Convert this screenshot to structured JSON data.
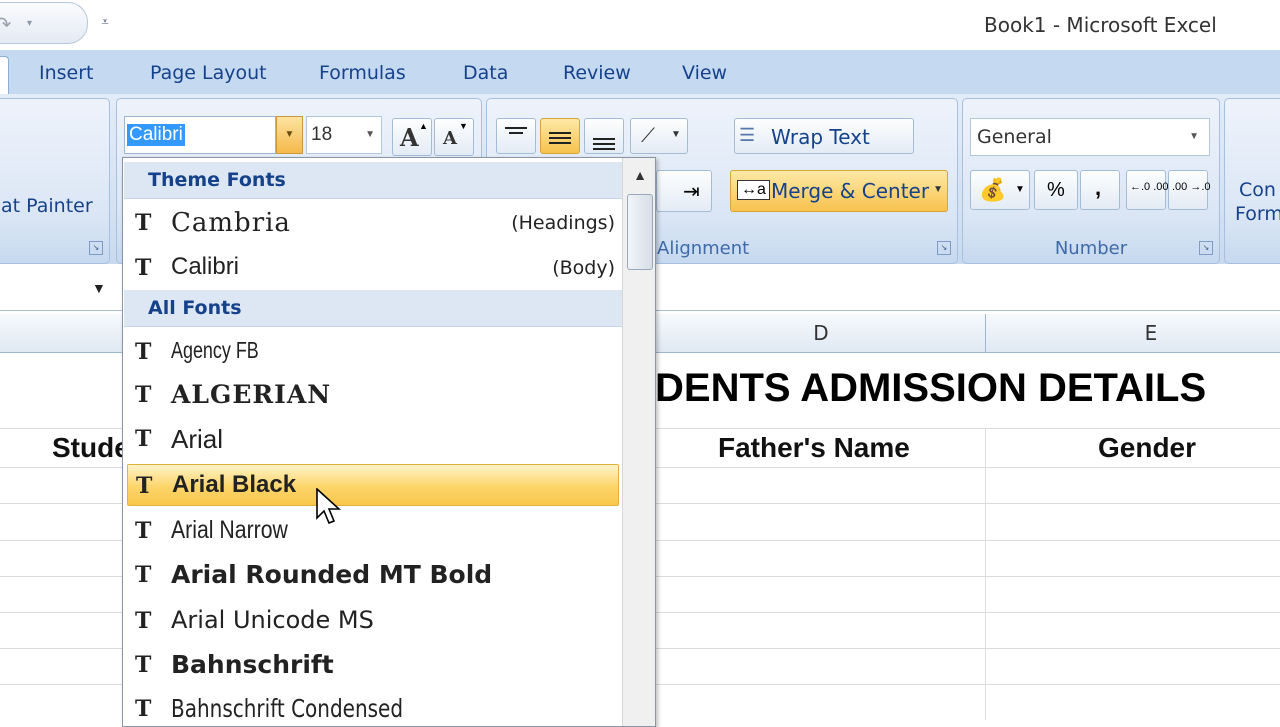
{
  "window": {
    "title": "Book1 - Microsoft Excel"
  },
  "ribbon": {
    "tabs": [
      "Insert",
      "Page Layout",
      "Formulas",
      "Data",
      "Review",
      "View"
    ],
    "clipboard": {
      "format_painter_label": "at Painter"
    },
    "font": {
      "name_value": "Calibri",
      "size_value": "18"
    },
    "alignment": {
      "wrap_text_label": "Wrap Text",
      "merge_center_label": "Merge & Center",
      "group_label": "Alignment"
    },
    "number": {
      "format_value": "General",
      "percent_label": "%",
      "comma_label": ",",
      "increase_decimal": "←.0 .00",
      "decrease_decimal": ".00 →.0",
      "group_label": "Number"
    },
    "styles": {
      "conditional_label_1": "Con",
      "conditional_label_2": "Form"
    }
  },
  "font_dropdown": {
    "theme_header": "Theme Fonts",
    "theme_fonts": [
      {
        "name": "Cambria",
        "note": "(Headings)"
      },
      {
        "name": "Calibri",
        "note": "(Body)"
      }
    ],
    "all_header": "All Fonts",
    "all_fonts": [
      {
        "name": "Agency FB"
      },
      {
        "name": "ALGERIAN"
      },
      {
        "name": "Arial"
      },
      {
        "name": "Arial Black"
      },
      {
        "name": "Arial Narrow"
      },
      {
        "name": "Arial Rounded MT Bold"
      },
      {
        "name": "Arial Unicode MS"
      },
      {
        "name": "Bahnschrift"
      },
      {
        "name": "Bahnschrift Condensed"
      }
    ],
    "highlighted": "Arial Black"
  },
  "sheet": {
    "columns": [
      "D",
      "E"
    ],
    "title": "DENTS ADMISSION DETAILS",
    "headers": {
      "student": "Stude",
      "father": "Father's Name",
      "gender": "Gender"
    }
  },
  "icons": {
    "redo": "redo-icon",
    "customize": "qat-customize-icon",
    "font_item": "truetype-font-icon",
    "scroll_up": "scroll-up-icon"
  },
  "colors": {
    "accent": "#15428b",
    "ribbon": "#c5d9f1",
    "highlight": "#fcd56b",
    "selection": "#3399ff"
  }
}
